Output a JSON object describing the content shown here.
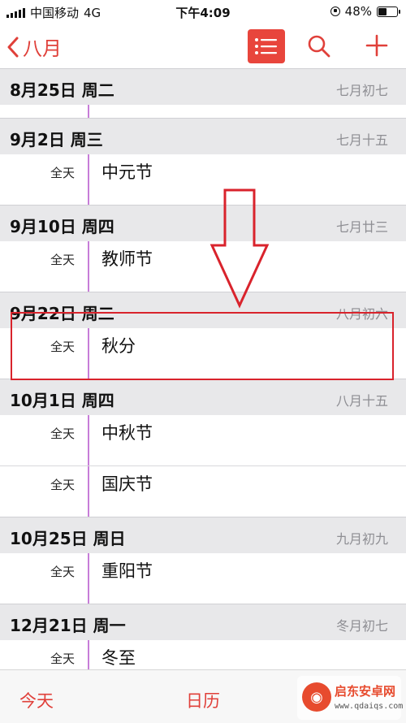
{
  "status_bar": {
    "carrier": "中国移动",
    "network": "4G",
    "time": "下午4:09",
    "battery_percent": "48%",
    "battery_level": 0.48
  },
  "nav": {
    "back_label": "八月",
    "icons": [
      "chevron-left-icon",
      "list-icon",
      "search-icon",
      "plus-icon"
    ],
    "accent_color": "#e8453c"
  },
  "days": [
    {
      "date": "8月25日 周二",
      "lunar": "七月初七",
      "events": []
    },
    {
      "date": "9月2日 周三",
      "lunar": "七月十五",
      "events": [
        {
          "time": "全天",
          "title": "中元节"
        }
      ]
    },
    {
      "date": "9月10日 周四",
      "lunar": "七月廿三",
      "events": [
        {
          "time": "全天",
          "title": "教师节"
        }
      ]
    },
    {
      "date": "9月22日 周二",
      "lunar": "八月初六",
      "events": [
        {
          "time": "全天",
          "title": "秋分"
        }
      ]
    },
    {
      "date": "10月1日 周四",
      "lunar": "八月十五",
      "events": [
        {
          "time": "全天",
          "title": "中秋节"
        },
        {
          "time": "全天",
          "title": "国庆节"
        }
      ]
    },
    {
      "date": "10月25日 周日",
      "lunar": "九月初九",
      "events": [
        {
          "time": "全天",
          "title": "重阳节"
        }
      ]
    },
    {
      "date": "12月21日 周一",
      "lunar": "冬月初七",
      "events": [
        {
          "time": "全天",
          "title": "冬至"
        }
      ]
    }
  ],
  "tab_bar": {
    "today_label": "今天",
    "calendar_label": "日历"
  },
  "watermark": {
    "title": "启东安卓网",
    "url": "www.qdaiqs.com"
  }
}
